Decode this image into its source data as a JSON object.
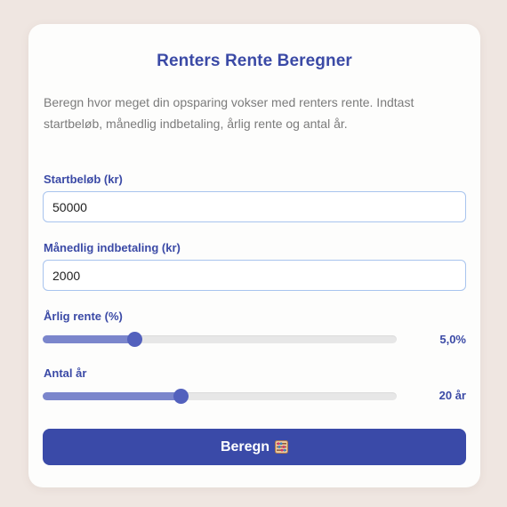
{
  "calculator": {
    "title": "Renters Rente Beregner",
    "description": "Beregn hvor meget din opsparing vokser med renters rente. Indtast startbeløb, månedlig indbetaling, årlig rente og antal år.",
    "start_amount": {
      "label": "Startbeløb (kr)",
      "value": "50000"
    },
    "monthly_deposit": {
      "label": "Månedlig indbetaling (kr)",
      "value": "2000"
    },
    "annual_rate": {
      "label": "Årlig rente (%)",
      "value_text": "5,0%",
      "fraction": 0.26
    },
    "years": {
      "label": "Antal år",
      "value_text": "20 år",
      "fraction": 0.39
    },
    "button": {
      "label": "Beregn",
      "icon": "abacus-icon"
    }
  },
  "colors": {
    "accent": "#3a4aa8",
    "slider_fill": "#7b86cc",
    "slider_thumb": "#5361bd",
    "background": "#efe6e1"
  }
}
